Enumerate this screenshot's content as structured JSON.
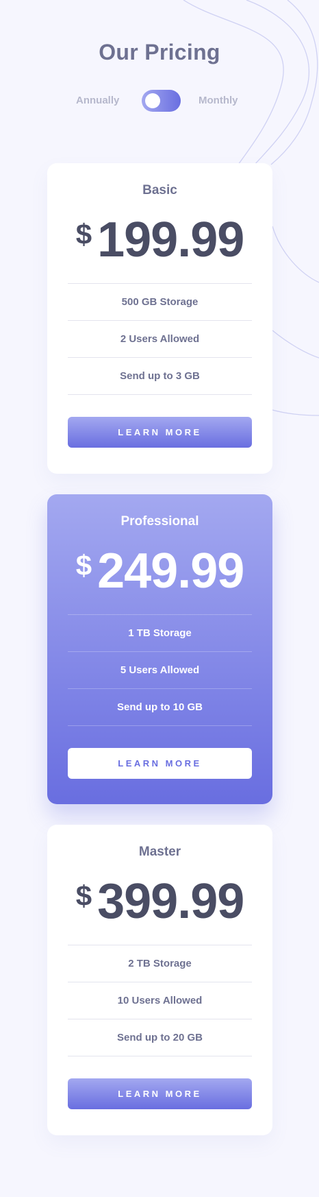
{
  "header": {
    "title": "Our Pricing"
  },
  "billing_toggle": {
    "left_label": "Annually",
    "right_label": "Monthly",
    "state": "annually"
  },
  "colors": {
    "background": "#f6f6fe",
    "accent_gradient_start": "#a3a8f0",
    "accent_gradient_end": "#696ee0",
    "heading_text": "#6e7191",
    "price_text": "#4a4d64"
  },
  "plans": [
    {
      "name": "Basic",
      "currency": "$",
      "price": "199.99",
      "features": [
        "500 GB Storage",
        "2 Users Allowed",
        "Send up to 3 GB"
      ],
      "cta_label": "LEARN MORE",
      "highlighted": false
    },
    {
      "name": "Professional",
      "currency": "$",
      "price": "249.99",
      "features": [
        "1 TB Storage",
        "5 Users Allowed",
        "Send up to 10 GB"
      ],
      "cta_label": "LEARN MORE",
      "highlighted": true
    },
    {
      "name": "Master",
      "currency": "$",
      "price": "399.99",
      "features": [
        "2 TB Storage",
        "10 Users Allowed",
        "Send up to 20 GB"
      ],
      "cta_label": "LEARN MORE",
      "highlighted": false
    }
  ]
}
